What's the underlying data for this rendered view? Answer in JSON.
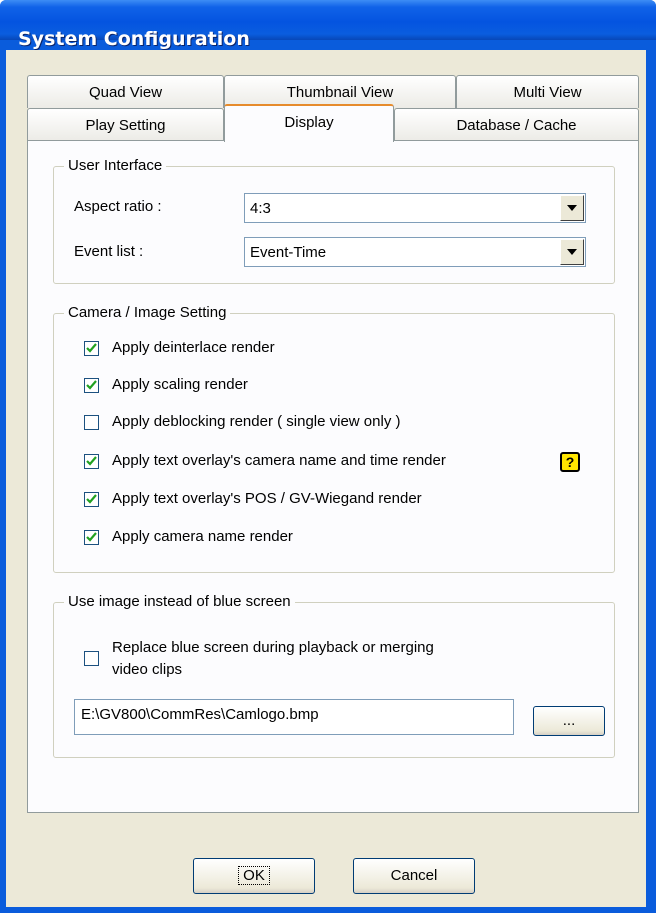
{
  "window": {
    "title": "System Configuration"
  },
  "tabs_row1": [
    "Quad View",
    "Thumbnail View",
    "Multi View"
  ],
  "tabs_row2": [
    "Play Setting",
    "Display",
    "Database / Cache"
  ],
  "user_interface": {
    "legend": "User Interface",
    "aspect_label": "Aspect ratio :",
    "aspect_value": "4:3",
    "event_label": "Event list :",
    "event_value": "Event-Time"
  },
  "camera": {
    "legend": "Camera / Image Setting",
    "items": [
      {
        "label": "Apply deinterlace render",
        "checked": true
      },
      {
        "label": "Apply scaling render",
        "checked": true
      },
      {
        "label": "Apply deblocking render ( single view only )",
        "checked": false
      },
      {
        "label": "Apply text overlay's camera name and time render",
        "checked": true
      },
      {
        "label": "Apply text overlay's POS / GV-Wiegand render",
        "checked": true
      },
      {
        "label": "Apply camera name render",
        "checked": true
      }
    ],
    "help_icon": "?"
  },
  "blue_screen": {
    "legend": "Use image instead of blue screen",
    "replace_label_line1": "Replace blue screen during playback or merging",
    "replace_label_line2": "video clips",
    "replace_checked": false,
    "path": "E:\\GV800\\CommRes\\Camlogo.bmp",
    "browse_label": "..."
  },
  "footer": {
    "ok_label": "OK",
    "cancel_label": "Cancel"
  }
}
